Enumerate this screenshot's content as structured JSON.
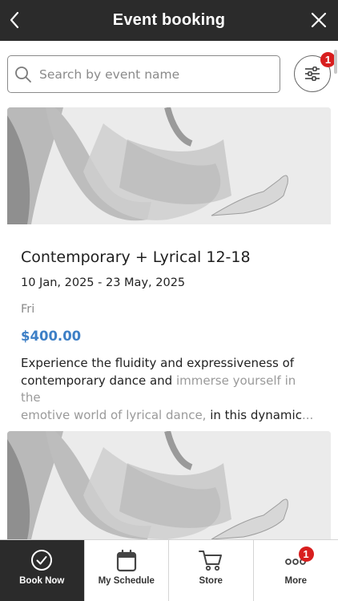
{
  "header": {
    "title": "Event booking"
  },
  "search": {
    "placeholder": "Search by event name"
  },
  "filter": {
    "badge": "1"
  },
  "event": {
    "title": "Contemporary + Lyrical 12-18",
    "dates": "10 Jan, 2025 - 23 May, 2025",
    "day": "Fri",
    "price": "$400.00",
    "description_line1": "Experience the fluidity and expressiveness of",
    "description_line2_start": "contemporary dance and ",
    "description_line2_fade": "immerse yourself in the",
    "description_line3_fade": "emotive world of lyrical dance, ",
    "description_line3_end": "in this dynamic",
    "ellipsis": "..."
  },
  "tabbar": {
    "tabs": [
      {
        "label": "Book Now",
        "icon": "check-circle-icon",
        "active": true
      },
      {
        "label": "My Schedule",
        "icon": "calendar-icon",
        "active": false
      },
      {
        "label": "Store",
        "icon": "cart-icon",
        "active": false
      },
      {
        "label": "More",
        "icon": "more-dots-icon",
        "active": false,
        "badge": "1"
      }
    ]
  },
  "colors": {
    "header_bg": "#2b2b2b",
    "price": "#3d7fc6",
    "badge": "#d81e1e"
  }
}
